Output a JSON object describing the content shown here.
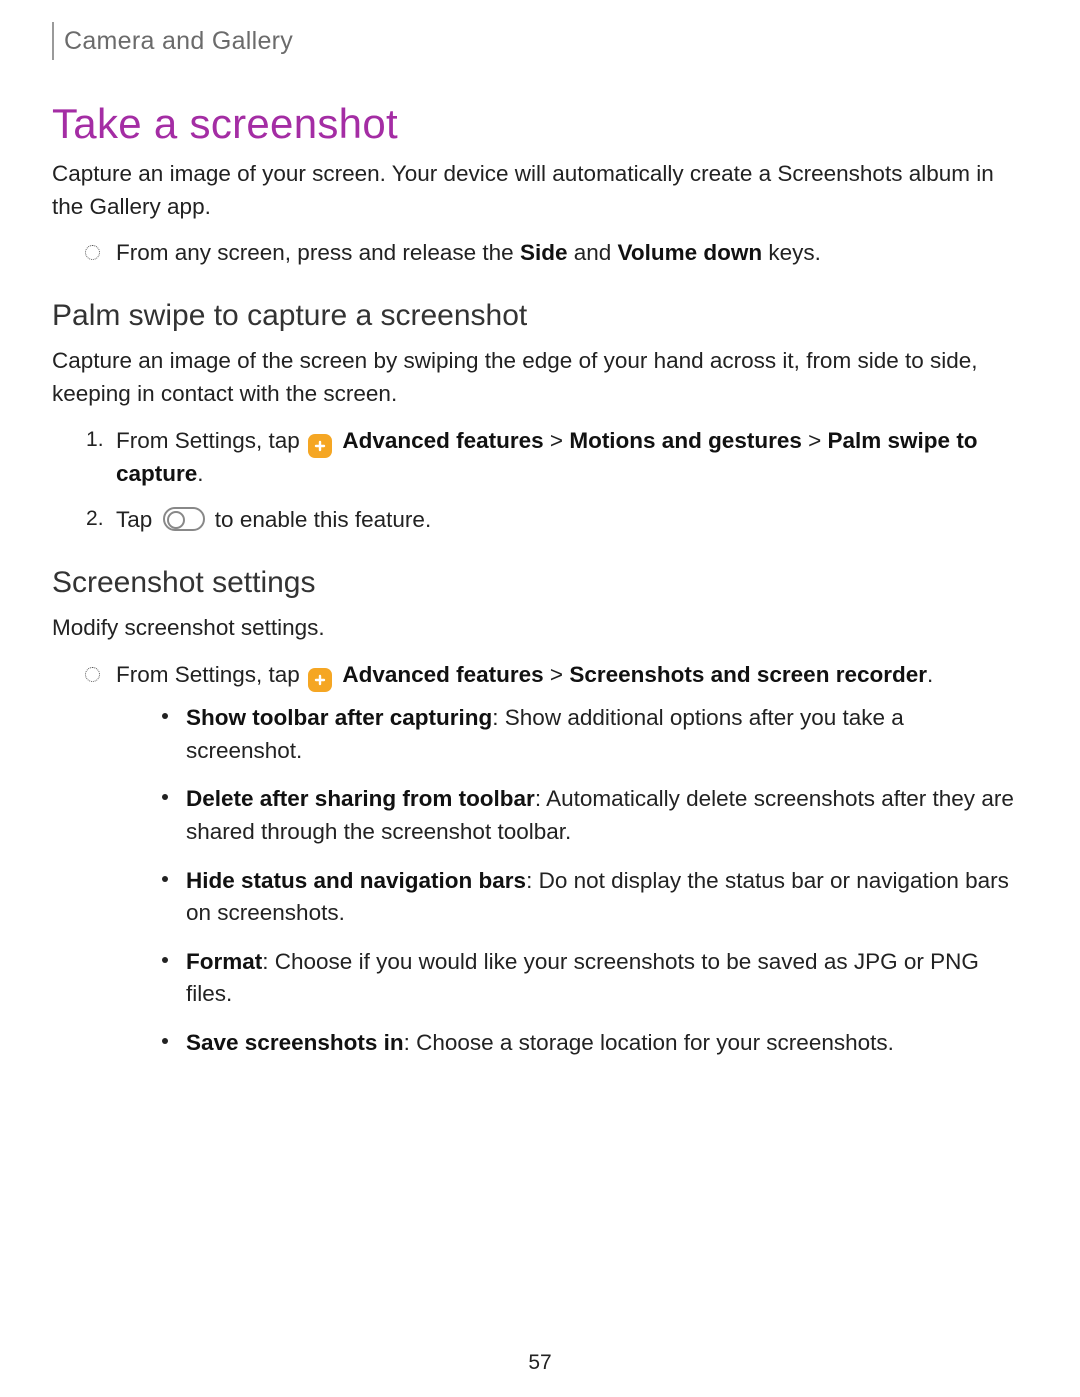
{
  "breadcrumb": "Camera and Gallery",
  "title": "Take a screenshot",
  "intro": "Capture an image of your screen. Your device will automatically create a Screenshots album in the Gallery app.",
  "howto": {
    "prefix": "From any screen, press and release the ",
    "key1": "Side",
    "mid": " and ",
    "key2": "Volume down",
    "suffix": " keys."
  },
  "palm": {
    "heading": "Palm swipe to capture a screenshot",
    "intro": "Capture an image of the screen by swiping the edge of your hand across it, from side to side, keeping in contact with the screen.",
    "step1": {
      "prefix": "From Settings, tap ",
      "b1": "Advanced features",
      "sep1": " > ",
      "b2": "Motions and gestures",
      "sep2": " > ",
      "b3": "Palm swipe to capture",
      "suffix": "."
    },
    "step2": {
      "prefix": "Tap ",
      "suffix": "to enable this feature."
    }
  },
  "settings": {
    "heading": "Screenshot settings",
    "intro": "Modify screenshot settings.",
    "lead": {
      "prefix": "From Settings, tap ",
      "b1": "Advanced features",
      "sep": " > ",
      "b2": "Screenshots and screen recorder",
      "suffix": "."
    },
    "items": [
      {
        "label": "Show toolbar after capturing",
        "desc": ": Show additional options after you take a screenshot."
      },
      {
        "label": "Delete after sharing from toolbar",
        "desc": ": Automatically delete screenshots after they are shared through the screenshot toolbar."
      },
      {
        "label": "Hide status and navigation bars",
        "desc": ": Do not display the status bar or navigation bars on screenshots."
      },
      {
        "label": "Format",
        "desc": ": Choose if you would like your screenshots to be saved as JPG or PNG files."
      },
      {
        "label": "Save screenshots in",
        "desc": ": Choose a storage location for your screenshots."
      }
    ]
  },
  "page_number": "57"
}
